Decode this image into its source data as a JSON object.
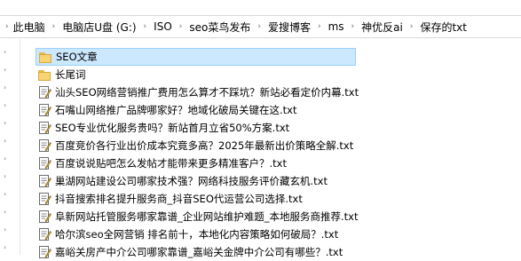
{
  "breadcrumb": {
    "items": [
      "此电脑",
      "电脑店U盘 (G:)",
      "ISO",
      "seo菜鸟发布",
      "爱搜博客",
      "ms",
      "神优反ai",
      "保存的txt"
    ]
  },
  "files": [
    {
      "name": "SEO文章",
      "type": "folder",
      "selected": true
    },
    {
      "name": "长尾词",
      "type": "folder",
      "selected": false
    },
    {
      "name": "汕头SEO网络营销推广费用怎么算才不踩坑？新站必看定价内幕.txt",
      "type": "txt"
    },
    {
      "name": "石嘴山网络推广品牌哪家好？地域化破局关键在这.txt",
      "type": "txt"
    },
    {
      "name": "SEO专业优化服务贵吗？新站首月立省50%方案.txt",
      "type": "txt"
    },
    {
      "name": "百度竞价各行业出价成本究竟多高？2025年最新出价策略全解.txt",
      "type": "txt"
    },
    {
      "name": "百度说说贴吧怎么发帖才能带来更多精准客户？.txt",
      "type": "txt"
    },
    {
      "name": "巢湖网站建设公司哪家技术强？网络科技服务评价藏玄机.txt",
      "type": "txt"
    },
    {
      "name": "抖音搜索排名提升服务商_抖音SEO代运营公司选择.txt",
      "type": "txt"
    },
    {
      "name": "阜新网站托管服务哪家靠谱_企业网站维护难题_本地服务商推荐.txt",
      "type": "txt"
    },
    {
      "name": "哈尔滨seo全网营销 排名前十，本地化内容策略如何破局？.txt",
      "type": "txt"
    },
    {
      "name": "嘉峪关房产中介公司哪家靠谱_嘉峪关金牌中介公司有哪些？.txt",
      "type": "txt"
    }
  ]
}
